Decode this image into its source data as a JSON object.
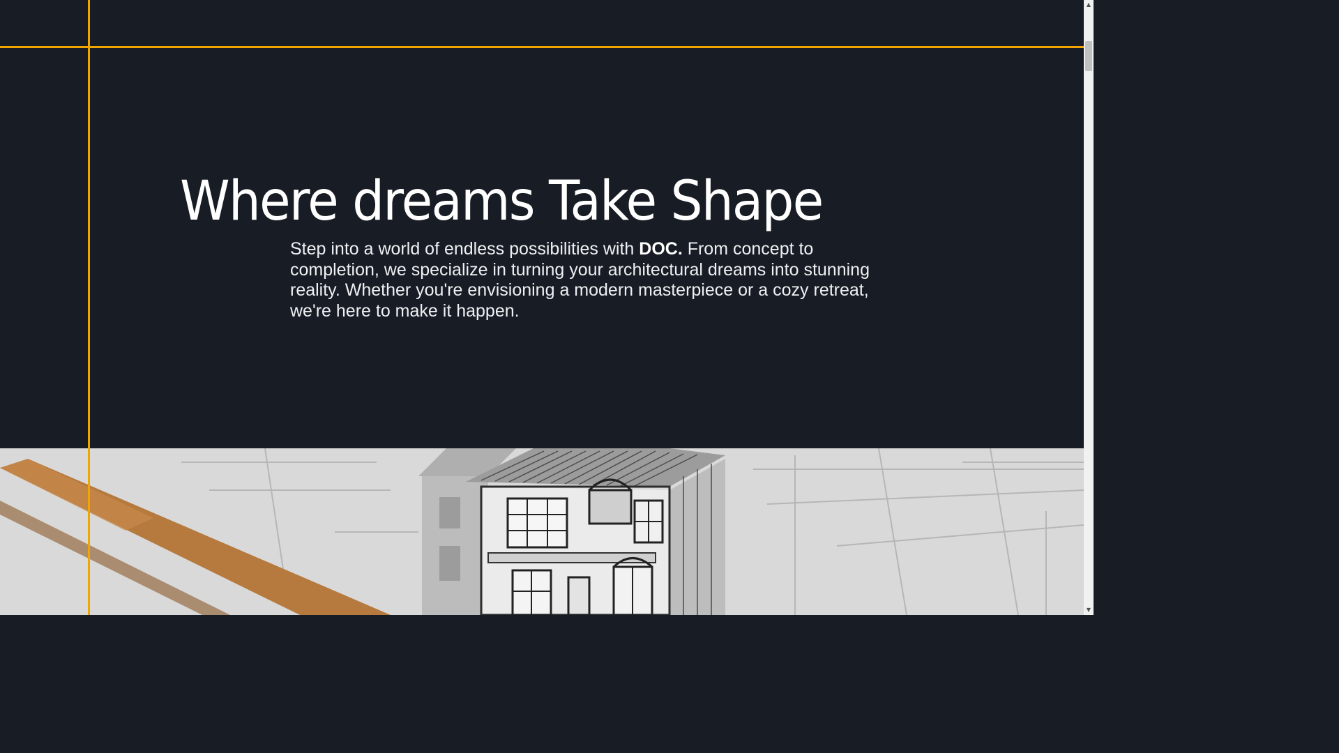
{
  "hero": {
    "title": "Where dreams Take Shape",
    "text_before": "Step into a world of endless possibilities with ",
    "brand": "DOC.",
    "text_after": " From concept to completion, we specialize in turning your architectural dreams into stunning reality. Whether you're envisioning a modern masterpiece or a cozy retreat, we're here to make it happen."
  },
  "image": {
    "subject": "architectural-house-model-on-blueprints-with-pencil"
  },
  "colors": {
    "background": "#181c24",
    "accent": "#f0a500",
    "text": "#ffffff"
  },
  "scrollbar": {
    "up_glyph": "▲",
    "down_glyph": "▼"
  }
}
